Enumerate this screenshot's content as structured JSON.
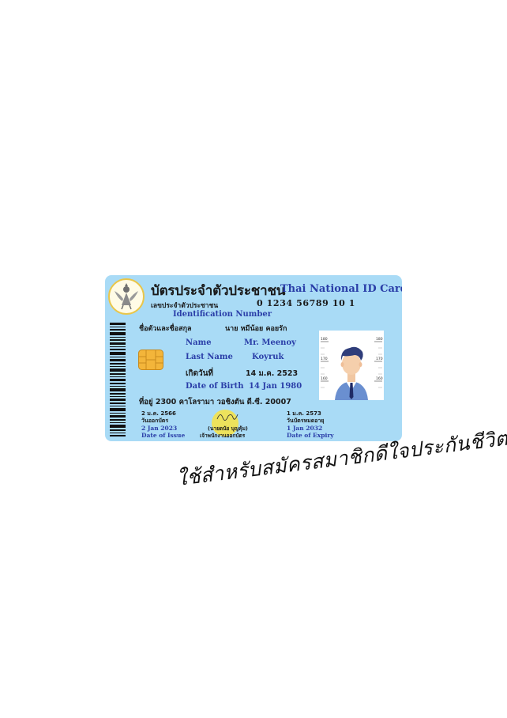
{
  "card": {
    "title_th": "บัตรประจำตัวประชาชน",
    "title_en": "Thai National ID Card",
    "id_number_label_th": "เลขประจำตัวประชาชน",
    "id_number_value": "0 1234 56789 10 1",
    "id_number_label_en": "Identification Number",
    "name_th_label": "ชื่อตัวและชื่อสกุล",
    "name_th_value": "นาย หมีน้อย คอยรัก",
    "name_en_label": "Name",
    "name_en_value": "Mr. Meenoy",
    "lastname_en_label": "Last Name",
    "lastname_en_value": "Koyruk",
    "birth_th_label": "เกิดวันที่",
    "birth_th_value": "14 ม.ค. 2523",
    "birth_en_label": "Date of Birth",
    "birth_en_value": "14 Jan 1980",
    "address": "ที่อยู่ 2300 คาโลรามา วอชิงตัน ดี.ซี. 20007",
    "issue_date_th": "2 ม.ค. 2566",
    "issue_label_th": "วันออกบัตร",
    "issue_date_en": "2 Jan 2023",
    "issue_label_en": "Date of Issue",
    "officer_name": "(นายดนัย บุญคุ้ม)",
    "officer_title": "เจ้าพนักงานออกบัตร",
    "expiry_date_th": "1 ม.ค. 2573",
    "expiry_label_th": "วันบัตรหมดอายุ",
    "expiry_date_en": "1 Jan 2032",
    "expiry_label_en": "Date of Expiry",
    "height_marks": [
      "180",
      "170",
      "160"
    ],
    "colors": {
      "card_bg": "#a9dbf6",
      "english_text": "#2a3ea8",
      "thai_text": "#1a1a1a"
    }
  },
  "handwritten_note": "ใช้สำหรับสมัครสมาชิกดีใจประกันชีวิต"
}
